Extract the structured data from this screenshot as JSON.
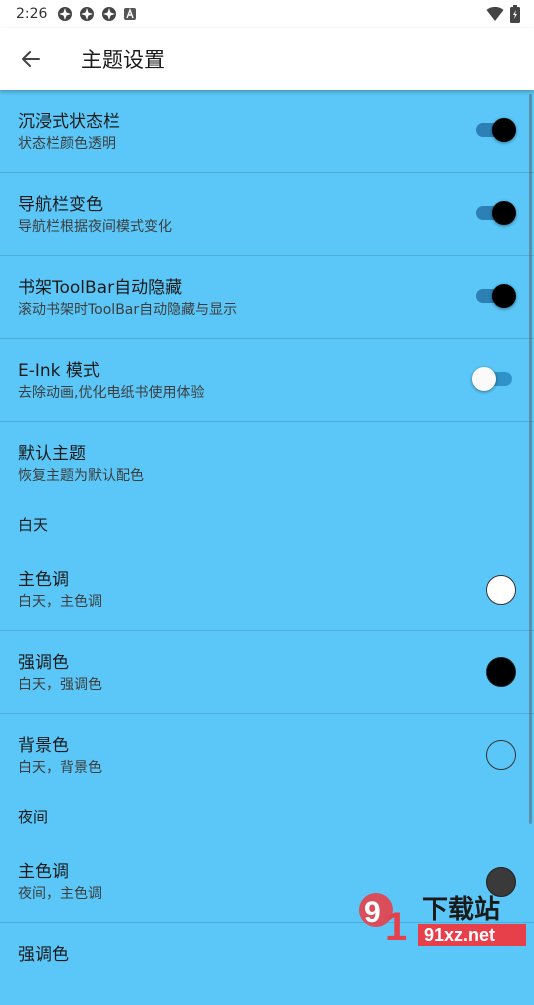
{
  "status_bar": {
    "time": "2:26"
  },
  "app_bar": {
    "title": "主题设置"
  },
  "settings": [
    {
      "title": "沉浸式状态栏",
      "subtitle": "状态栏颜色透明",
      "control": "switch",
      "on": true
    },
    {
      "title": "导航栏变色",
      "subtitle": "导航栏根据夜间模式变化",
      "control": "switch",
      "on": true
    },
    {
      "title": "书架ToolBar自动隐藏",
      "subtitle": "滚动书架时ToolBar自动隐藏与显示",
      "control": "switch",
      "on": true
    },
    {
      "title": "E-Ink 模式",
      "subtitle": "去除动画,优化电纸书使用体验",
      "control": "switch",
      "on": false
    },
    {
      "title": "默认主题",
      "subtitle": "恢复主题为默认配色",
      "control": "none"
    }
  ],
  "day_section": {
    "label": "白天",
    "items": [
      {
        "title": "主色调",
        "subtitle": "白天，主色调",
        "color": "#FFFFFF"
      },
      {
        "title": "强调色",
        "subtitle": "白天，强调色",
        "color": "#000000"
      },
      {
        "title": "背景色",
        "subtitle": "白天，背景色",
        "color": "#5BC7F8"
      }
    ]
  },
  "night_section": {
    "label": "夜间",
    "items": [
      {
        "title": "主色调",
        "subtitle": "夜间，主色调",
        "color": "#3A3A3A"
      },
      {
        "title": "强调色"
      }
    ]
  },
  "watermark": {
    "text": "91下载站",
    "url_text": "91xz.net"
  },
  "colors": {
    "background": "#5BC7F8",
    "switch_track_on": "#2C80B5",
    "appbar": "#FFFFFF"
  }
}
